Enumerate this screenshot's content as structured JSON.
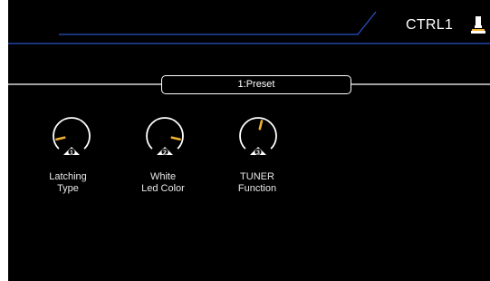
{
  "header": {
    "title": "CTRL1",
    "icon": "footswitch-icon"
  },
  "preset": {
    "label": "1:Preset"
  },
  "knobs": [
    {
      "number": "1",
      "value_line1": "Latching",
      "value_line2": "Type",
      "level": 0.12
    },
    {
      "number": "2",
      "value_line1": "White",
      "value_line2": "Led Color",
      "level": 0.88
    },
    {
      "number": "3",
      "value_line1": "TUNER",
      "value_line2": "Function",
      "level": 0.55
    }
  ],
  "colors": {
    "background": "#000000",
    "accent_blue": "#2a52c8",
    "pointer": "#f0b030",
    "text": "#ffffff"
  }
}
